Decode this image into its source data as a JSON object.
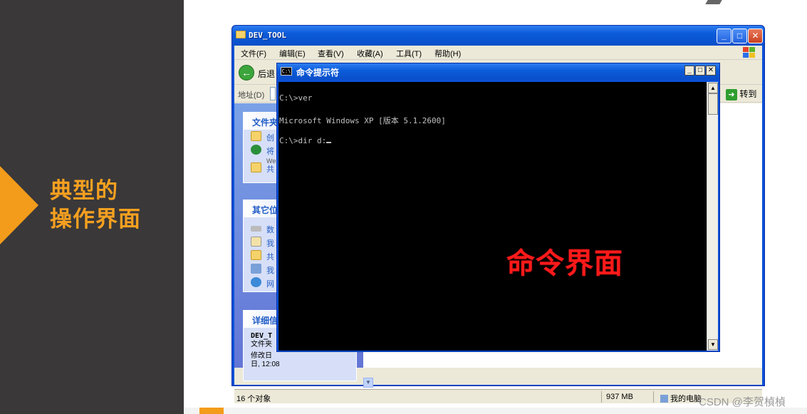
{
  "slide": {
    "title_line1": "典型的",
    "title_line2": "操作界面",
    "watermark": "CSDN @李贺楨楨"
  },
  "explorer": {
    "title": "DEV_TOOL",
    "menu": [
      "文件(F)",
      "编辑(E)",
      "查看(V)",
      "收藏(A)",
      "工具(T)",
      "帮助(H)"
    ],
    "back_label": "后退",
    "address_label": "地址(D)",
    "go_label": "转到",
    "task_pane": {
      "file_tasks_header": "文件夹",
      "file_tasks": [
        "创",
        "将",
        "共"
      ],
      "file_tasks_sub": "We",
      "other_places_header": "其它位",
      "other_places": [
        "数",
        "我",
        "共",
        "我",
        "网"
      ],
      "details_header": "详细信",
      "details_name": "DEV_T",
      "details_type": "文件夹",
      "details_modified": "修改日",
      "details_date": "日, 12:08"
    },
    "status": {
      "objects": "16 个对象",
      "size": "937 MB",
      "location": "我的电脑"
    }
  },
  "cmd": {
    "title": "命令提示符",
    "lines": [
      "C:\\>ver",
      "Microsoft Windows XP [版本 5.1.2600]",
      "C:\\>dir d:"
    ],
    "overlay_text": "命令界面"
  },
  "colors": {
    "accent_orange": "#f39c1b",
    "panel_dark": "#3a3839",
    "xp_blue": "#0a51d8",
    "cmd_label_red": "#ff1a1a"
  }
}
